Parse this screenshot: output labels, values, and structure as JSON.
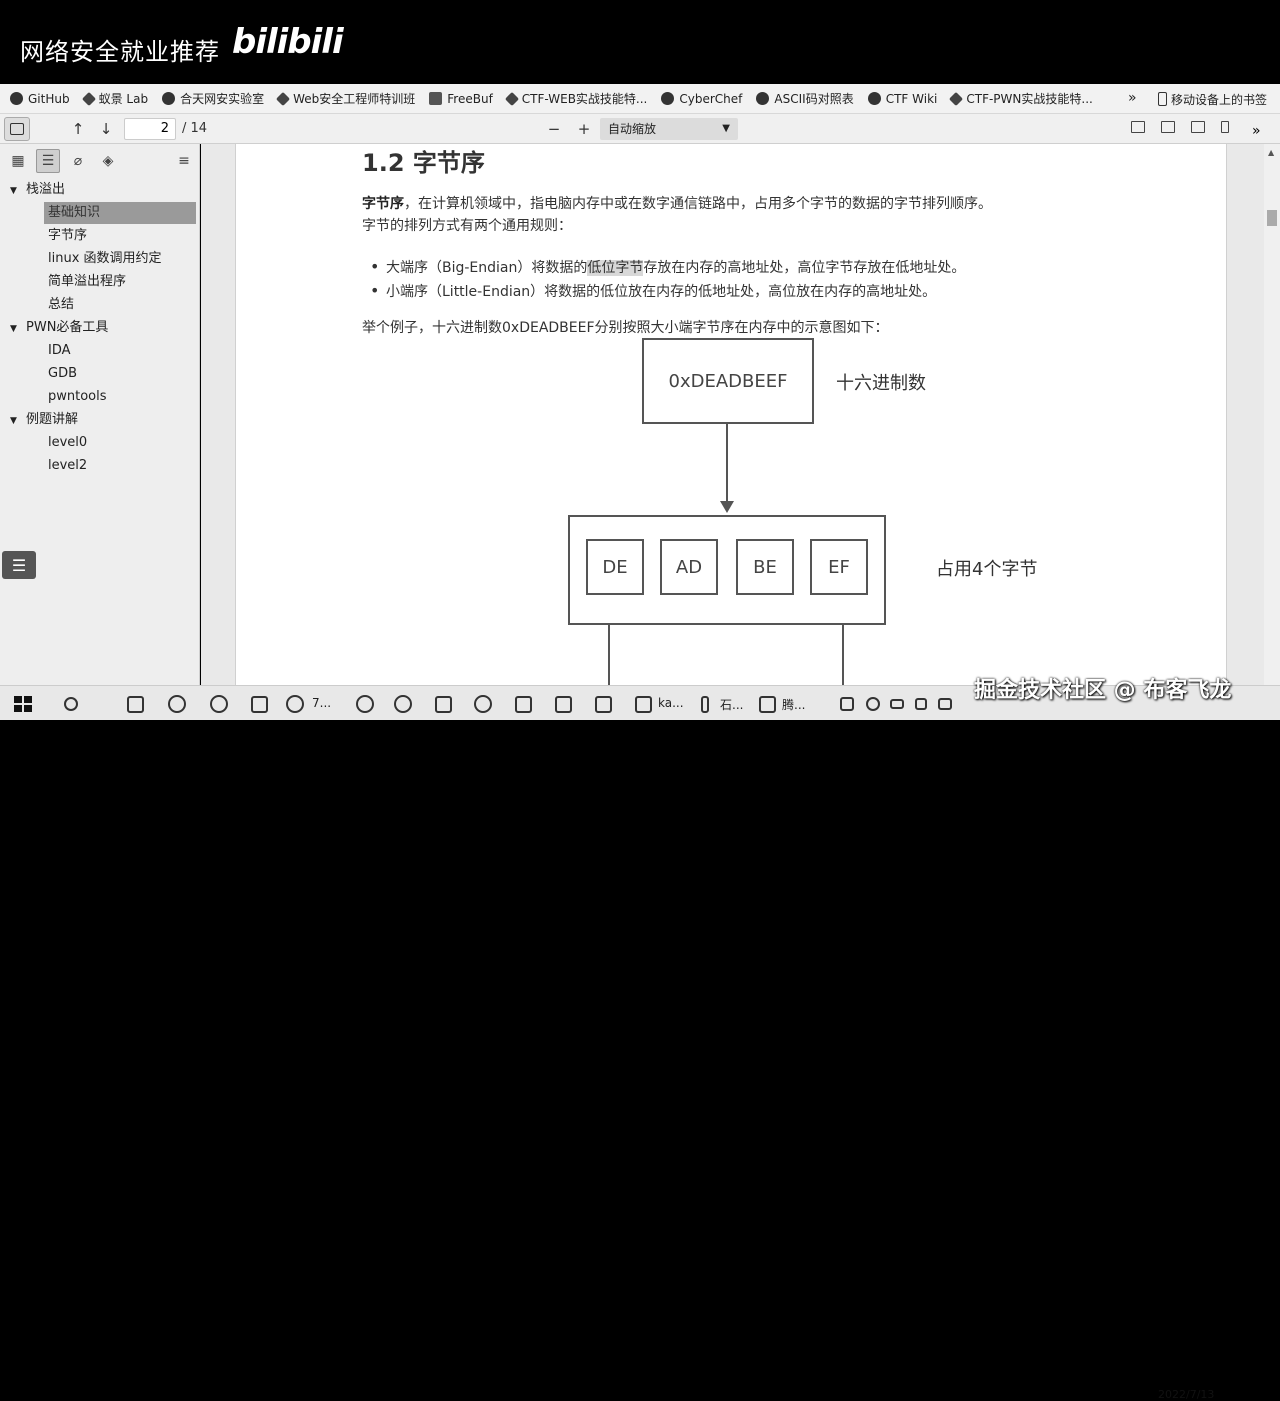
{
  "banner": {
    "title": "网络安全就业推荐",
    "logo": "bilibili"
  },
  "bookmarks": [
    {
      "label": "GitHub",
      "icon": "github-icon"
    },
    {
      "label": "蚁景 Lab",
      "icon": "shield-icon"
    },
    {
      "label": "合天网安实验室",
      "icon": "security-icon"
    },
    {
      "label": "Web安全工程师特训班",
      "icon": "diamond-icon"
    },
    {
      "label": "FreeBuf",
      "icon": "freebuf-icon"
    },
    {
      "label": "CTF-WEB实战技能特...",
      "icon": "diamond-icon"
    },
    {
      "label": "CyberChef",
      "icon": "chef-icon"
    },
    {
      "label": "ASCII码对照表",
      "icon": "c-icon"
    },
    {
      "label": "CTF Wiki",
      "icon": "ctf-icon"
    },
    {
      "label": "CTF-PWN实战技能特...",
      "icon": "diamond-icon"
    }
  ],
  "bookmarks_more": "»",
  "bookmarks_mobile": "移动设备上的书签",
  "toolbar": {
    "page_current": "2",
    "page_total": "/ 14",
    "zoom_out": "−",
    "zoom_in": "+",
    "zoom_value": "自动缩放",
    "up": "↑",
    "down": "↓"
  },
  "sidebar": {
    "outline": [
      {
        "label": "栈溢出",
        "level": 0
      },
      {
        "label": "基础知识",
        "level": 1,
        "selected": true
      },
      {
        "label": "字节序",
        "level": 1
      },
      {
        "label": "linux 函数调用约定",
        "level": 1
      },
      {
        "label": "简单溢出程序",
        "level": 1
      },
      {
        "label": "总结",
        "level": 1
      },
      {
        "label": "PWN必备工具",
        "level": 0
      },
      {
        "label": "IDA",
        "level": 1
      },
      {
        "label": "GDB",
        "level": 1
      },
      {
        "label": "pwntools",
        "level": 1
      },
      {
        "label": "例题讲解",
        "level": 0
      },
      {
        "label": "level0",
        "level": 1
      },
      {
        "label": "level2",
        "level": 1
      }
    ]
  },
  "doc": {
    "heading": "1.2 字节序",
    "p1_bold": "字节序",
    "p1_rest": "，在计算机领域中，指电脑内存中或在数字通信链路中，占用多个字节的数据的字节排列顺序。",
    "p2": "字节的排列方式有两个通用规则：",
    "b1_pre": "大端序（Big-Endian）将数据的",
    "b1_hl": "低位字节",
    "b1_post": "存放在内存的高地址处，高位字节存放在低地址处。",
    "b2": "小端序（Little-Endian）将数据的低位放在内存的低地址处，高位放在内存的高地址处。",
    "p3": "举个例子，十六进制数0xDEADBEEF分别按照大小端字节序在内存中的示意图如下：",
    "diagram": {
      "value": "0xDEADBEEF",
      "value_label": "十六进制数",
      "bytes": [
        "DE",
        "AD",
        "BE",
        "EF"
      ],
      "bytes_label": "占用4个字节"
    }
  },
  "taskbar": {
    "items": [
      "7...",
      "ka...",
      "石...",
      "腾..."
    ],
    "watermark": "掘金技术社区 @ 布客飞龙",
    "date": "2022/7/13"
  }
}
